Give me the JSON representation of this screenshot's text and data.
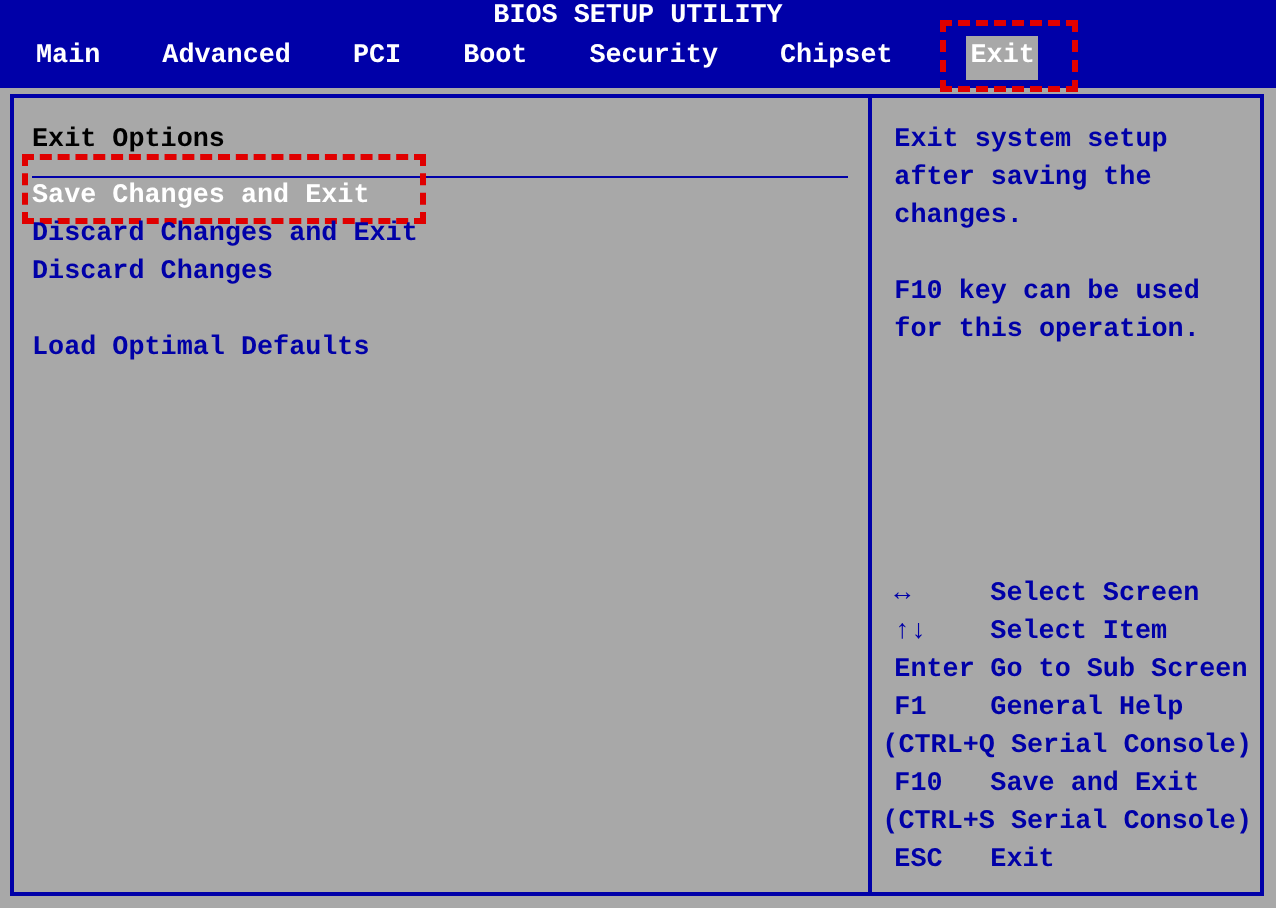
{
  "title": "BIOS SETUP UTILITY",
  "tabs": [
    {
      "label": "Main",
      "selected": false,
      "highlighted": false
    },
    {
      "label": "Advanced",
      "selected": false,
      "highlighted": false
    },
    {
      "label": "PCI",
      "selected": false,
      "highlighted": false
    },
    {
      "label": "Boot",
      "selected": false,
      "highlighted": false
    },
    {
      "label": "Security",
      "selected": false,
      "highlighted": false
    },
    {
      "label": "Chipset",
      "selected": false,
      "highlighted": false
    },
    {
      "label": "Exit",
      "selected": true,
      "highlighted": true
    }
  ],
  "menu": {
    "heading": "Exit Options",
    "groups": [
      [
        {
          "label": "Save Changes and Exit",
          "selected": true,
          "highlighted": true
        },
        {
          "label": "Discard Changes and Exit",
          "selected": false,
          "highlighted": false
        },
        {
          "label": "Discard Changes",
          "selected": false,
          "highlighted": false
        }
      ],
      [
        {
          "label": "Load Optimal Defaults",
          "selected": false,
          "highlighted": false
        }
      ]
    ]
  },
  "help": {
    "paragraphs": [
      "Exit system setup after saving the changes.",
      "F10 key can be used for this operation."
    ],
    "keys": [
      {
        "kind": "key",
        "key": "↔",
        "action": "Select Screen"
      },
      {
        "kind": "key",
        "key": "↑↓",
        "action": "Select Item"
      },
      {
        "kind": "key",
        "key": "Enter",
        "action": "Go to Sub Screen"
      },
      {
        "kind": "key",
        "key": "F1",
        "action": "General Help"
      },
      {
        "kind": "note",
        "text": "(CTRL+Q Serial Console)"
      },
      {
        "kind": "key",
        "key": "F10",
        "action": "Save and Exit"
      },
      {
        "kind": "note",
        "text": "(CTRL+S Serial Console)"
      },
      {
        "kind": "key",
        "key": "ESC",
        "action": "Exit"
      }
    ]
  }
}
